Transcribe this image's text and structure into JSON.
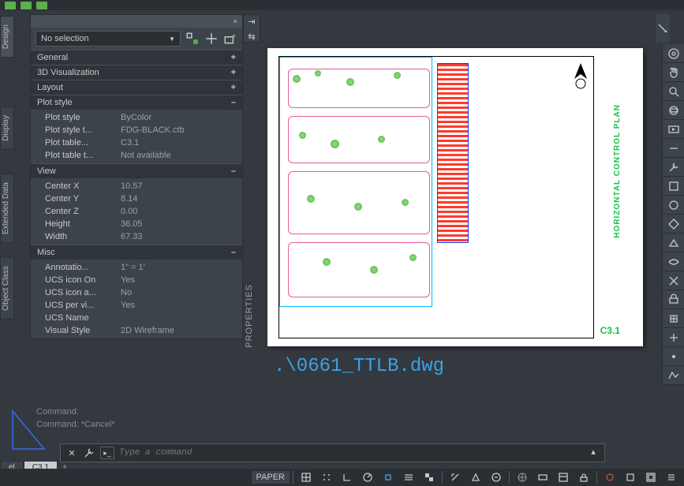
{
  "lefttabs": [
    "Design",
    "Display",
    "Extended Data",
    "Object Class"
  ],
  "active_lefttab": 0,
  "panel": {
    "selection": "No selection",
    "sections": {
      "general": {
        "label": "General",
        "expanded": false
      },
      "vis3d": {
        "label": "3D Visualization",
        "expanded": false
      },
      "layout": {
        "label": "Layout",
        "expanded": false
      },
      "plotstyle": {
        "label": "Plot style",
        "expanded": true,
        "rows": [
          {
            "label": "Plot style",
            "value": "ByColor"
          },
          {
            "label": "Plot style t...",
            "value": "FDG-BLACK.ctb"
          },
          {
            "label": "Plot table...",
            "value": "C3.1"
          },
          {
            "label": "Plot table t...",
            "value": "Not available"
          }
        ]
      },
      "view": {
        "label": "View",
        "expanded": true,
        "rows": [
          {
            "label": "Center X",
            "value": "10.57"
          },
          {
            "label": "Center Y",
            "value": "8.14"
          },
          {
            "label": "Center Z",
            "value": "0.00"
          },
          {
            "label": "Height",
            "value": "36.05"
          },
          {
            "label": "Width",
            "value": "67.33"
          }
        ]
      },
      "misc": {
        "label": "Misc",
        "expanded": true,
        "rows": [
          {
            "label": "Annotatio...",
            "value": "1\" = 1'"
          },
          {
            "label": "UCS icon On",
            "value": "Yes"
          },
          {
            "label": "UCS icon a...",
            "value": "No"
          },
          {
            "label": "UCS per vi...",
            "value": "Yes"
          },
          {
            "label": "UCS Name",
            "value": ""
          },
          {
            "label": "Visual Style",
            "value": "2D Wireframe"
          }
        ]
      }
    },
    "side_label": "PROPERTIES"
  },
  "command_history": [
    "Command:",
    "Command: *Cancel*"
  ],
  "command_input": {
    "placeholder": "Type a command"
  },
  "sheet": {
    "title": "HORIZONTAL CONTROL PLAN",
    "number": "C3.1"
  },
  "xref_text": ".\\0661_TTLB.dwg",
  "layout_tabs": {
    "items": [
      "el",
      "C3.1"
    ],
    "active": 1,
    "plus": "+"
  },
  "statusbar": {
    "space": "PAPER"
  }
}
